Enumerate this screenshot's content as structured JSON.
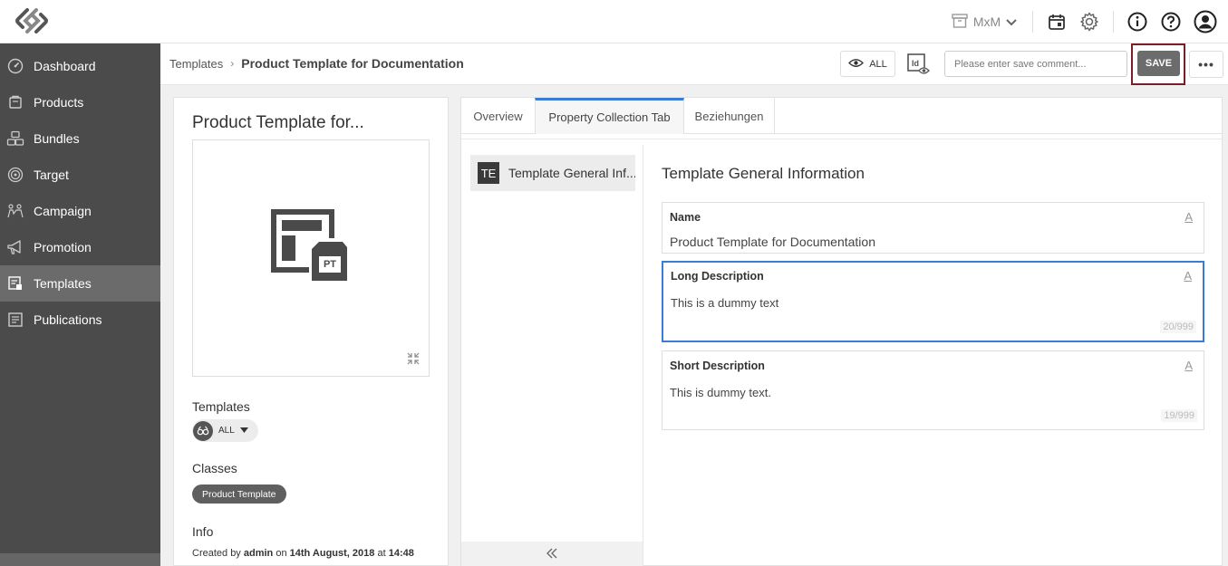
{
  "topbar": {
    "context_label": "MxM"
  },
  "sidebar": {
    "items": [
      {
        "label": "Dashboard",
        "icon": "dashboard-icon"
      },
      {
        "label": "Products",
        "icon": "products-icon"
      },
      {
        "label": "Bundles",
        "icon": "bundles-icon"
      },
      {
        "label": "Target",
        "icon": "target-icon"
      },
      {
        "label": "Campaign",
        "icon": "campaign-icon"
      },
      {
        "label": "Promotion",
        "icon": "megaphone-icon"
      },
      {
        "label": "Templates",
        "icon": "templates-icon",
        "active": true
      },
      {
        "label": "Publications",
        "icon": "publications-icon"
      }
    ]
  },
  "breadcrumb": {
    "parent": "Templates",
    "current": "Product Template for Documentation"
  },
  "toolbar": {
    "view_all_label": "ALL",
    "comment_placeholder": "Please enter save comment...",
    "save_label": "SAVE",
    "more_label": "•••"
  },
  "left_panel": {
    "title": "Product Template for...",
    "image_badge": "PT",
    "templates_label": "Templates",
    "templates_chip": "ALL",
    "classes_label": "Classes",
    "class_chip": "Product Template",
    "info_label": "Info",
    "info": {
      "created_by_prefix": "Created by",
      "user": "admin",
      "on": "on",
      "date": "14th August, 2018",
      "at": "at",
      "time": "14:48"
    }
  },
  "tabs": [
    {
      "label": "Overview"
    },
    {
      "label": "Property Collection Tab",
      "active": true
    },
    {
      "label": "Beziehungen"
    }
  ],
  "collections": [
    {
      "badge": "TE",
      "label": "Template General Inf..."
    }
  ],
  "section": {
    "title": "Template General Information",
    "fields": [
      {
        "label": "Name",
        "value": "Product Template for Documentation"
      },
      {
        "label": "Long Description",
        "value": "This is a dummy text",
        "count": "20/999"
      },
      {
        "label": "Short Description",
        "value": "This is dummy text.",
        "count": "19/999"
      }
    ],
    "field_type_icon": "A"
  },
  "colors": {
    "sidebar_bg": "#4b4b4b",
    "sidebar_active": "#6b6b6b",
    "accent_blue": "#3a7bd5",
    "save_highlight": "#7a1f2a"
  }
}
